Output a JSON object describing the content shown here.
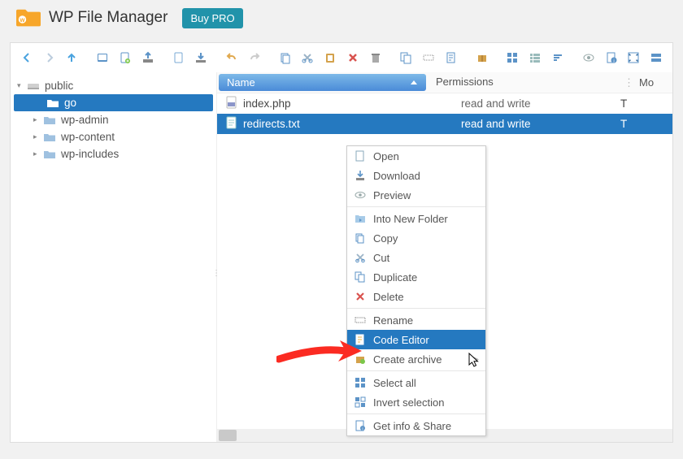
{
  "header": {
    "title": "WP File Manager",
    "buy_label": "Buy PRO"
  },
  "tree": {
    "root": "public",
    "items": [
      {
        "label": "go",
        "selected": true
      },
      {
        "label": "wp-admin"
      },
      {
        "label": "wp-content"
      },
      {
        "label": "wp-includes"
      }
    ]
  },
  "columns": {
    "name": "Name",
    "permissions": "Permissions",
    "modified": "Mo"
  },
  "files": [
    {
      "name": "index.php",
      "perm": "read and write",
      "mod": "T",
      "selected": false,
      "type": "php"
    },
    {
      "name": "redirects.txt",
      "perm": "read and write",
      "mod": "T",
      "selected": true,
      "type": "txt"
    }
  ],
  "context_menu": {
    "open": "Open",
    "download": "Download",
    "preview": "Preview",
    "into_new_folder": "Into New Folder",
    "copy": "Copy",
    "cut": "Cut",
    "duplicate": "Duplicate",
    "delete": "Delete",
    "rename": "Rename",
    "code_editor": "Code Editor",
    "create_archive": "Create archive",
    "select_all": "Select all",
    "invert_selection": "Invert selection",
    "get_info": "Get info & Share"
  }
}
